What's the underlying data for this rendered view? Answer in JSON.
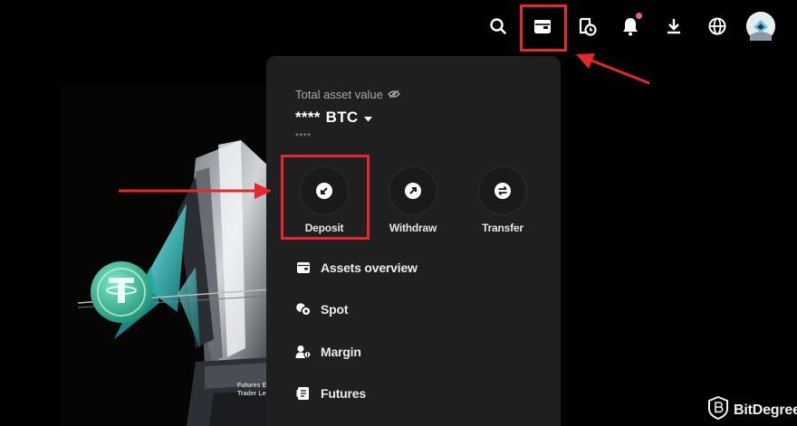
{
  "topbar": {
    "icons": [
      "search-icon",
      "wallet-icon",
      "order-history-icon",
      "bell-icon",
      "download-icon",
      "globe-icon",
      "avatar"
    ]
  },
  "wallet_panel": {
    "total_label": "Total asset value",
    "total_value": "****",
    "currency": "BTC",
    "sub_value": "****",
    "actions": [
      {
        "label": "Deposit",
        "icon": "deposit-icon"
      },
      {
        "label": "Withdraw",
        "icon": "withdraw-icon"
      },
      {
        "label": "Transfer",
        "icon": "transfer-icon"
      }
    ],
    "menu": [
      {
        "label": "Assets overview",
        "icon": "wallet-icon"
      },
      {
        "label": "Spot",
        "icon": "spot-icon"
      },
      {
        "label": "Margin",
        "icon": "margin-icon"
      },
      {
        "label": "Futures",
        "icon": "futures-icon"
      }
    ]
  },
  "hero": {
    "line1": "Futures E",
    "line2": "Trader Leade"
  },
  "watermark": {
    "text": "BitDegree"
  },
  "colors": {
    "background": "#000000",
    "panel": "#1f1f1f",
    "highlight": "#e8262e",
    "notification": "#ef5f6b"
  }
}
